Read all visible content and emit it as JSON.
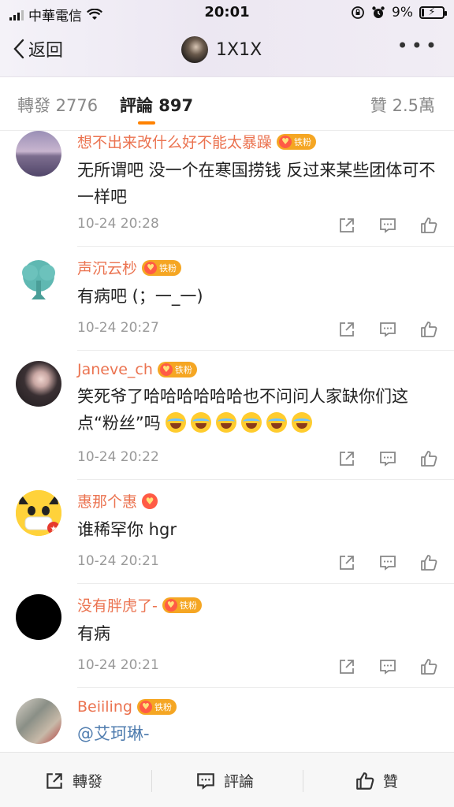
{
  "status": {
    "carrier": "中華電信",
    "time": "20:01",
    "battery": "9%"
  },
  "nav": {
    "back_label": "返回",
    "title": "1X1X",
    "more": "•••"
  },
  "tabs": {
    "repost": "轉發 2776",
    "comments": "評論 897",
    "likes": "贊 2.5萬"
  },
  "comments": [
    {
      "user": "想不出来改什么好不能太暴躁",
      "badge": "铁粉",
      "text": "无所谓吧 没一个在寒国捞钱 反过来某些团体可不一样吧",
      "time": "10-24 20:28"
    },
    {
      "user": "声沉云杪",
      "badge": "铁粉",
      "text": "有病吧 (；一_一)",
      "time": "10-24 20:27"
    },
    {
      "user": "Janeve_ch",
      "badge": "铁粉",
      "text": "笑死爷了哈哈哈哈哈哈也不问问人家缺你们这点“粉丝”吗",
      "time": "10-24 20:22"
    },
    {
      "user": "惠那个惠",
      "badge": "",
      "text": "谁稀罕你 hgr",
      "time": "10-24 20:21"
    },
    {
      "user": "没有胖虎了-",
      "badge": "铁粉",
      "text": "有病",
      "time": "10-24 20:21"
    },
    {
      "user": "Beiiling",
      "badge": "铁粉",
      "text": "@艾珂琳-",
      "time": ""
    }
  ],
  "bottom": {
    "repost": "轉發",
    "comment": "評論",
    "like": "贊"
  },
  "colors": {
    "username": "#eb7350",
    "tab_accent": "#ff8200",
    "badge": "#f5a623",
    "mention": "#507daf"
  }
}
